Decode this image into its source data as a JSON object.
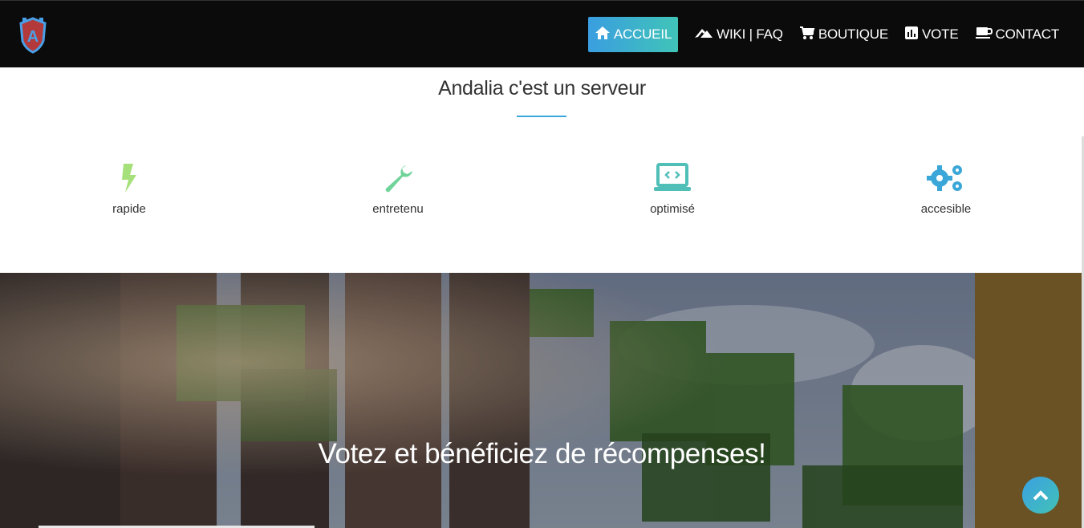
{
  "nav": {
    "items": [
      {
        "label": "ACCUEIL",
        "icon": "home-icon",
        "active": true
      },
      {
        "label": "WIKI | FAQ",
        "icon": "wiki-icon",
        "active": false
      },
      {
        "label": "BOUTIQUE",
        "icon": "cart-icon",
        "active": false
      },
      {
        "label": "VOTE",
        "icon": "chart-icon",
        "active": false
      },
      {
        "label": "CONTACT",
        "icon": "coffee-icon",
        "active": false
      }
    ]
  },
  "intro": {
    "title": "Andalia c'est un serveur",
    "features": [
      {
        "label": "rapide",
        "icon": "bolt-icon",
        "color": "#a6e07a"
      },
      {
        "label": "entretenu",
        "icon": "wrench-icon",
        "color": "#6fd39a"
      },
      {
        "label": "optimisé",
        "icon": "laptop-code-icon",
        "color": "#4fbfb8"
      },
      {
        "label": "accesible",
        "icon": "gears-icon",
        "color": "#3aa7d8"
      }
    ]
  },
  "hero": {
    "title": "Votez et bénéficiez de récompenses!"
  },
  "colors": {
    "nav_bg": "#0b0b0b",
    "accent_start": "#3a9ee0",
    "accent_end": "#40c4b8"
  }
}
